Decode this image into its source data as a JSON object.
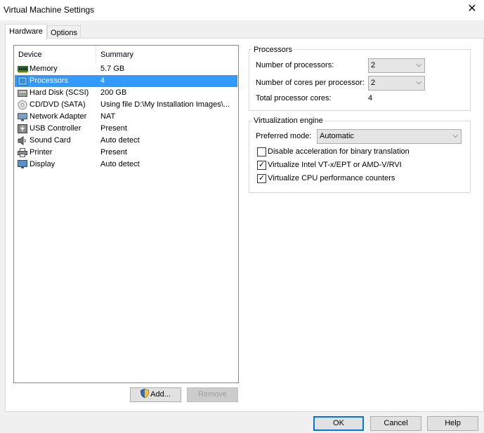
{
  "window": {
    "title": "Virtual Machine Settings"
  },
  "tabs": [
    {
      "label": "Hardware"
    },
    {
      "label": "Options"
    }
  ],
  "device_list": {
    "headers": {
      "device": "Device",
      "summary": "Summary"
    },
    "items": [
      {
        "icon": "memory-icon",
        "device": "Memory",
        "summary": "5.7 GB"
      },
      {
        "icon": "processor-icon",
        "device": "Processors",
        "summary": "4"
      },
      {
        "icon": "hard-disk-icon",
        "device": "Hard Disk (SCSI)",
        "summary": "200 GB"
      },
      {
        "icon": "cd-dvd-icon",
        "device": "CD/DVD (SATA)",
        "summary": "Using file D:\\My Installation Images\\..."
      },
      {
        "icon": "network-adapter-icon",
        "device": "Network Adapter",
        "summary": "NAT"
      },
      {
        "icon": "usb-icon",
        "device": "USB Controller",
        "summary": "Present"
      },
      {
        "icon": "sound-card-icon",
        "device": "Sound Card",
        "summary": "Auto detect"
      },
      {
        "icon": "printer-icon",
        "device": "Printer",
        "summary": "Present"
      },
      {
        "icon": "display-icon",
        "device": "Display",
        "summary": "Auto detect"
      }
    ],
    "selected": "Processors"
  },
  "list_buttons": {
    "add": "Add...",
    "remove": "Remove"
  },
  "processors": {
    "group_label": "Processors",
    "num_processors_label": "Number of processors:",
    "num_processors_value": "2",
    "cores_label": "Number of cores per processor:",
    "cores_value": "2",
    "total_label": "Total processor cores:",
    "total_value": "4"
  },
  "virtualization": {
    "group_label": "Virtualization engine",
    "mode_label": "Preferred mode:",
    "mode_value": "Automatic",
    "options": [
      {
        "label": "Disable acceleration for binary translation",
        "checked": false
      },
      {
        "label": "Virtualize Intel VT-x/EPT or AMD-V/RVI",
        "checked": true
      },
      {
        "label": "Virtualize CPU performance counters",
        "checked": true
      }
    ]
  },
  "footer": {
    "ok": "OK",
    "cancel": "Cancel",
    "help": "Help"
  },
  "colors": {
    "selection": "#3399ff",
    "accent": "#0078d7"
  }
}
